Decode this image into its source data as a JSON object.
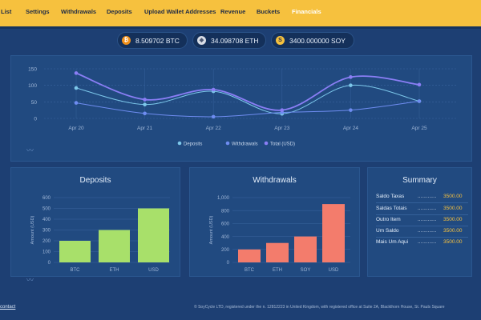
{
  "nav": {
    "items": [
      {
        "label": "List",
        "active": false
      },
      {
        "label": "Settings",
        "active": false
      },
      {
        "label": "Withdrawals",
        "active": false
      },
      {
        "label": "Deposits",
        "active": false
      },
      {
        "label": "Upload Wallet Addresses",
        "active": false
      },
      {
        "label": "Revenue",
        "active": false
      },
      {
        "label": "Buckets",
        "active": false
      },
      {
        "label": "Financials",
        "active": true
      }
    ]
  },
  "balances": [
    {
      "amount": "8.509702",
      "unit": "BTC",
      "icon": "bitcoin-icon",
      "color": "#f0901a"
    },
    {
      "amount": "34.098708",
      "unit": "ETH",
      "icon": "ethereum-icon",
      "color": "#d8dde6"
    },
    {
      "amount": "3400.000000",
      "unit": "SOY",
      "icon": "soy-token-icon",
      "color": "#f6c13e"
    }
  ],
  "colors": {
    "accent": "#f6c13e",
    "deposits": "#7cc7ea",
    "withdrawals": "#6e8cf0",
    "total": "#8a7ef5",
    "deposit_bar": "#a8e06a",
    "withdrawal_bar": "#f37c6c"
  },
  "summary": {
    "title": "Summary",
    "rows": [
      {
        "label": "Saldo Taxas",
        "value": "3500.00"
      },
      {
        "label": "Saldas Totais",
        "value": "3500.00"
      },
      {
        "label": "Outro Item",
        "value": "3500.00"
      },
      {
        "label": "Um Saldo",
        "value": "3500.00"
      },
      {
        "label": "Mais Um Aqui",
        "value": "3500.00"
      }
    ]
  },
  "footer": {
    "link": "contact",
    "text": "© SoyCycle LTD, registered under the n. 12812223 in United Kingdom, with registered office at Suite 2A, Blackthorn House, St. Pauls Square"
  },
  "chart_data": [
    {
      "type": "line",
      "x": [
        "Apr 20",
        "Apr 21",
        "Apr 22",
        "Apr 23",
        "Apr 24",
        "Apr 25"
      ],
      "ylim": [
        0,
        150
      ],
      "yticks": [
        "0",
        "50",
        "100",
        "150"
      ],
      "series": [
        {
          "name": "Deposits",
          "values": [
            92,
            42,
            82,
            14,
            100,
            52
          ]
        },
        {
          "name": "Withdrawals",
          "values": [
            47,
            15,
            5,
            18,
            25,
            52
          ]
        },
        {
          "name": "Total (USD)",
          "values": [
            137,
            57,
            87,
            25,
            125,
            102
          ]
        }
      ],
      "legend": "bottom"
    },
    {
      "type": "bar",
      "title": "Deposits",
      "ylabel": "Amount (USD)",
      "categories": [
        "BTC",
        "ETH",
        "USD"
      ],
      "values": [
        200,
        300,
        500
      ],
      "ylim": [
        0,
        600
      ],
      "yticks": [
        "0",
        "100",
        "200",
        "300",
        "400",
        "500",
        "600"
      ]
    },
    {
      "type": "bar",
      "title": "Withdrawals",
      "ylabel": "Amount (USD)",
      "categories": [
        "BTC",
        "ETH",
        "SOY",
        "USD"
      ],
      "values": [
        200,
        300,
        400,
        900
      ],
      "ylim": [
        0,
        1000
      ],
      "yticks": [
        "0",
        "200",
        "400",
        "600",
        "800",
        "1,000"
      ]
    }
  ]
}
